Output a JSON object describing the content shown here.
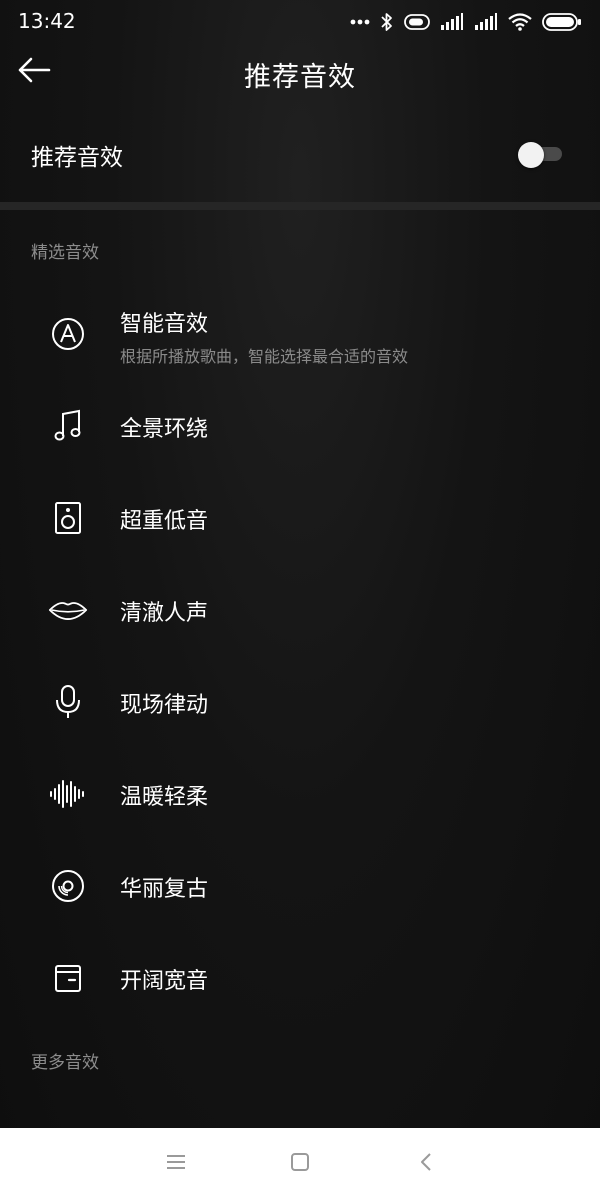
{
  "status_bar": {
    "time": "13:42"
  },
  "header": {
    "title": "推荐音效"
  },
  "toggle": {
    "label": "推荐音效",
    "enabled": false
  },
  "sections": {
    "featured_title": "精选音效",
    "more_title": "更多音效"
  },
  "effects": [
    {
      "title": "智能音效",
      "subtitle": "根据所播放歌曲，智能选择最合适的音效",
      "icon": "auto-a-icon"
    },
    {
      "title": "全景环绕",
      "icon": "music-note-icon"
    },
    {
      "title": "超重低音",
      "icon": "speaker-icon"
    },
    {
      "title": "清澈人声",
      "icon": "lips-icon"
    },
    {
      "title": "现场律动",
      "icon": "microphone-icon"
    },
    {
      "title": "温暖轻柔",
      "icon": "sound-wave-icon"
    },
    {
      "title": "华丽复古",
      "icon": "vinyl-record-icon"
    },
    {
      "title": "开阔宽音",
      "icon": "wallet-icon"
    }
  ],
  "colors": {
    "background": "#141414",
    "text_primary": "#ffffff",
    "text_secondary": "#8a8a8a",
    "toggle_track": "#4a4a4a",
    "nav_bar": "#ffffff"
  }
}
